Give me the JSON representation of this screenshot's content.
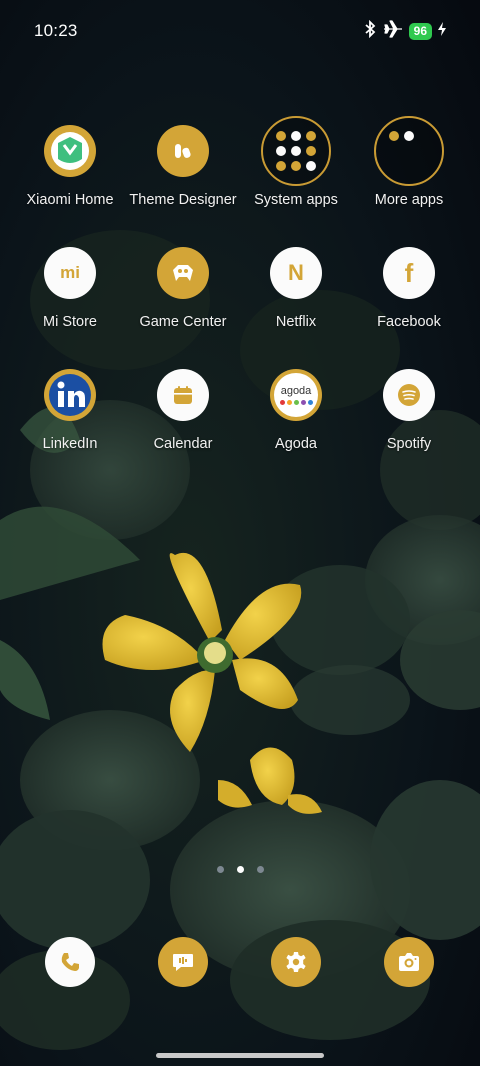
{
  "status_bar": {
    "time": "10:23",
    "battery": "96"
  },
  "apps": [
    {
      "name": "xiaomi-home",
      "label": "Xiaomi Home",
      "icon": "xiaomi-home-icon"
    },
    {
      "name": "theme-designer",
      "label": "Theme Designer",
      "icon": "theme-designer-icon"
    },
    {
      "name": "system-apps",
      "label": "System apps",
      "icon": "folder-icon"
    },
    {
      "name": "more-apps",
      "label": "More apps",
      "icon": "folder-icon"
    },
    {
      "name": "mi-store",
      "label": "Mi Store",
      "icon": "mi-store-icon"
    },
    {
      "name": "game-center",
      "label": "Game Center",
      "icon": "game-center-icon"
    },
    {
      "name": "netflix",
      "label": "Netflix",
      "icon": "netflix-icon"
    },
    {
      "name": "facebook",
      "label": "Facebook",
      "icon": "facebook-icon"
    },
    {
      "name": "linkedin",
      "label": "LinkedIn",
      "icon": "linkedin-icon"
    },
    {
      "name": "calendar",
      "label": "Calendar",
      "icon": "calendar-icon"
    },
    {
      "name": "agoda",
      "label": "Agoda",
      "icon": "agoda-icon",
      "icon_text": "agoda"
    },
    {
      "name": "spotify",
      "label": "Spotify",
      "icon": "spotify-icon"
    }
  ],
  "dock": [
    {
      "name": "phone",
      "icon": "phone-icon"
    },
    {
      "name": "messages",
      "icon": "messages-icon"
    },
    {
      "name": "settings",
      "icon": "gear-icon"
    },
    {
      "name": "camera",
      "icon": "camera-icon"
    }
  ],
  "pager": {
    "pages": 3,
    "current": 2
  },
  "colors": {
    "accent": "#d3a537",
    "icon_white": "#fbfbfb",
    "battery": "#2fc94f",
    "flower": "#e9c53a"
  }
}
